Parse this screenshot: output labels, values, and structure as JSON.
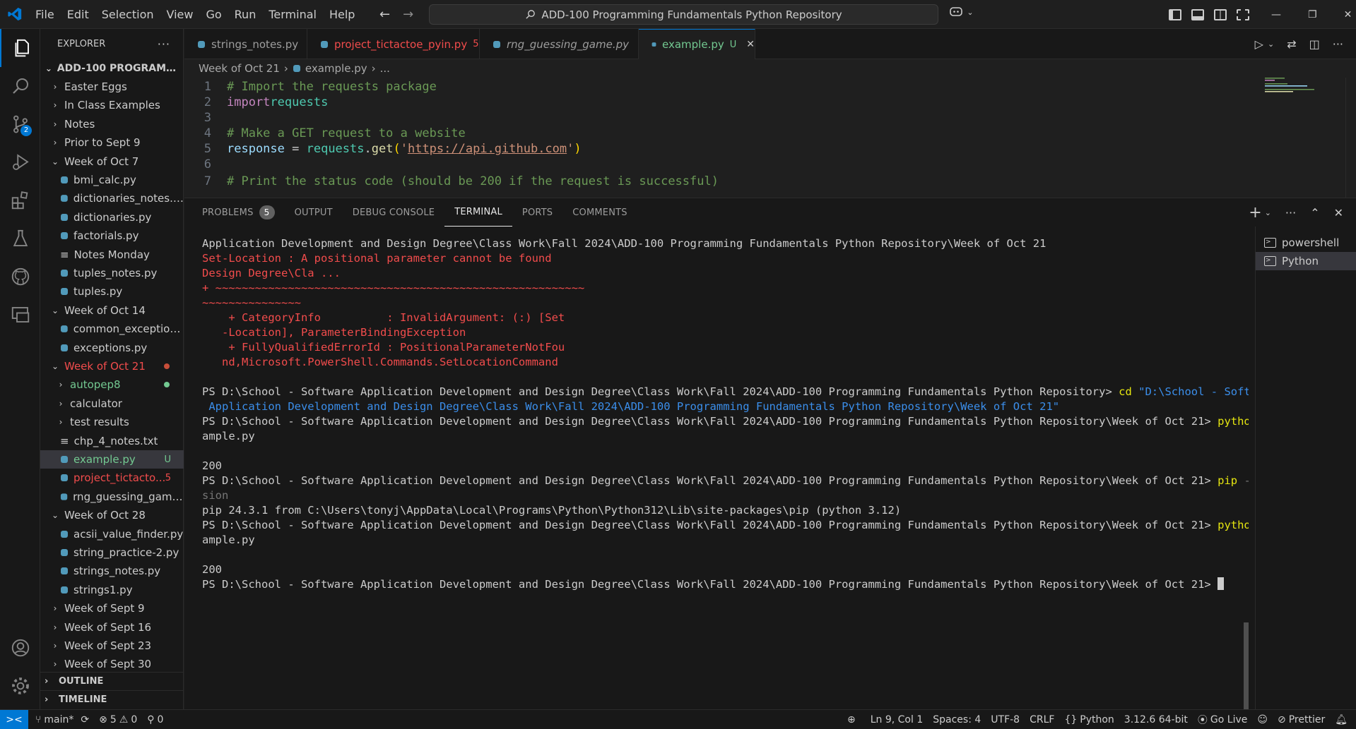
{
  "titlebar": {
    "menu": [
      "File",
      "Edit",
      "Selection",
      "View",
      "Go",
      "Run",
      "Terminal",
      "Help"
    ],
    "command_center": "ADD-100 Programming Fundamentals Python Repository"
  },
  "colors": {
    "accent": "#0078d4",
    "modified": "#e2c08d",
    "error": "#f14c4c",
    "untracked": "#73c991",
    "python_icon": "#519aba"
  },
  "activitybar": {
    "items": [
      "explorer-icon",
      "search-icon",
      "source-control-icon",
      "run-debug-icon",
      "extensions-icon",
      "testing-icon",
      "github-icon",
      "remote-explorer-icon"
    ],
    "scm_badge": "2",
    "bottom": [
      "accounts-icon",
      "settings-gear-icon"
    ]
  },
  "sidebar": {
    "title": "EXPLORER",
    "more": "···",
    "root": "ADD-100 PROGRAMMING...",
    "rows": [
      {
        "label": "Easter Eggs",
        "type": "folder",
        "depth": 1
      },
      {
        "label": "In Class Examples",
        "type": "folder",
        "depth": 1
      },
      {
        "label": "Notes",
        "type": "folder",
        "depth": 1
      },
      {
        "label": "Prior to Sept 9",
        "type": "folder",
        "depth": 1
      },
      {
        "label": "Week of Oct 7",
        "type": "folder-open",
        "depth": 1
      },
      {
        "label": "bmi_calc.py",
        "type": "py",
        "depth": 2
      },
      {
        "label": "dictionaries_notes.py",
        "type": "py",
        "depth": 2
      },
      {
        "label": "dictionaries.py",
        "type": "py",
        "depth": 2
      },
      {
        "label": "factorials.py",
        "type": "py",
        "depth": 2
      },
      {
        "label": "Notes Monday",
        "type": "txt",
        "depth": 2
      },
      {
        "label": "tuples_notes.py",
        "type": "py",
        "depth": 2
      },
      {
        "label": "tuples.py",
        "type": "py",
        "depth": 2
      },
      {
        "label": "Week of Oct 14",
        "type": "folder-open",
        "depth": 1
      },
      {
        "label": "common_exception...",
        "type": "py",
        "depth": 2
      },
      {
        "label": "exceptions.py",
        "type": "py",
        "depth": 2
      },
      {
        "label": "Week of Oct 21",
        "type": "folder-open",
        "depth": 1
      },
      {
        "label": "autopep8",
        "type": "folder",
        "depth": 2
      },
      {
        "label": "calculator",
        "type": "folder",
        "depth": 2
      },
      {
        "label": "test results",
        "type": "folder",
        "depth": 2
      },
      {
        "label": "chp_4_notes.txt",
        "type": "txt",
        "depth": 2
      },
      {
        "label": "example.py",
        "type": "py",
        "depth": 2
      },
      {
        "label": "project_tictacto...",
        "type": "py",
        "depth": 2
      },
      {
        "label": "rng_guessing_game....",
        "type": "py",
        "depth": 2
      },
      {
        "label": "Week of Oct 28",
        "type": "folder-open",
        "depth": 1
      },
      {
        "label": "acsii_value_finder.py",
        "type": "py",
        "depth": 2
      },
      {
        "label": "string_practice-2.py",
        "type": "py",
        "depth": 2
      },
      {
        "label": "strings_notes.py",
        "type": "py",
        "depth": 2
      },
      {
        "label": "strings1.py",
        "type": "py",
        "depth": 2
      },
      {
        "label": "Week of Sept 9",
        "type": "folder",
        "depth": 1
      },
      {
        "label": "Week of Sept 16",
        "type": "folder",
        "depth": 1
      },
      {
        "label": "Week of Sept 23",
        "type": "folder",
        "depth": 1
      },
      {
        "label": "Week of Sept 30",
        "type": "folder",
        "depth": 1
      }
    ],
    "example_deco": "U",
    "tictactoe_deco": "5",
    "outline": "OUTLINE",
    "timeline": "TIMELINE"
  },
  "tabs": [
    {
      "label": "strings_notes.py",
      "badge": ""
    },
    {
      "label": "project_tictactoe_pyin.py",
      "badge": "5"
    },
    {
      "label": "rng_guessing_game.py",
      "badge": ""
    },
    {
      "label": "example.py",
      "badge": "U"
    }
  ],
  "tab_close": "✕",
  "breadcrumb": {
    "folder": "Week of Oct 21",
    "file": "example.py",
    "more": "..."
  },
  "editor": {
    "line_numbers": [
      "1",
      "2",
      "3",
      "4",
      "5",
      "6",
      "7"
    ],
    "line1": "# Import the requests package",
    "line2_kw": "import",
    "line2_mod": "requests",
    "line4": "# Make a GET request to a website",
    "line5_var": "response",
    "line5_eq": " = ",
    "line5_mod": "requests",
    "line5_dot": ".",
    "line5_fn": "get",
    "line5_open": "(",
    "line5_q1": "'",
    "line5_url": "https://api.github.com",
    "line5_q2": "'",
    "line5_close": ")",
    "line7_partial": "# Print the status code (should be 200 if the request is successful)"
  },
  "panel": {
    "tabs": [
      "PROBLEMS",
      "OUTPUT",
      "DEBUG CONSOLE",
      "TERMINAL",
      "PORTS",
      "COMMENTS"
    ],
    "problems_count": "5",
    "terminals": [
      "powershell",
      "Python"
    ]
  },
  "terminal": {
    "l01": "Application Development and Design Degree\\Class Work\\Fall 2024\\ADD-100 Programming Fundamentals Python Repository\\Week of Oct 21",
    "l02": "Set-Location : A positional parameter cannot be found",
    "l03": "Design Degree\\Cla ...",
    "l04": "+ ~~~~~~~~~~~~~~~~~~~~~~~~~~~~~~~~~~~~~~~~~~~~~~~~~~~~~~~~",
    "l05": "~~~~~~~~~~~~~~~",
    "l06": "    + CategoryInfo          : InvalidArgument: (:) [Set",
    "l07": "   -Location], ParameterBindingException",
    "l08": "    + FullyQualifiedErrorId : PositionalParameterNotFou",
    "l09": "   nd,Microsoft.PowerShell.Commands.SetLocationCommand",
    "l10_prompt": "PS D:\\School - Software Application Development and Design Degree\\Class Work\\Fall 2024\\ADD-100 Programming Fundamentals Python Repository> ",
    "l10_cmd": "cd",
    "l10_arg": " \"D:\\School - Software",
    "l11": " Application Development and Design Degree\\Class Work\\Fall 2024\\ADD-100 Programming Fundamentals Python Repository\\Week of Oct 21\"",
    "prompt_oct21": "PS D:\\School - Software Application Development and Design Degree\\Class Work\\Fall 2024\\ADD-100 Programming Fundamentals Python Repository\\Week of Oct 21> ",
    "l12_cmd": "python ex",
    "l13": "ample.py",
    "l15": "200",
    "l16_cmd": "pip",
    "l16_arg": " --ver",
    "l17": "sion",
    "l18": "pip 24.3.1 from C:\\Users\\tonyj\\AppData\\Local\\Programs\\Python\\Python312\\Lib\\site-packages\\pip (python 3.12)",
    "l19_cmd": "python ex",
    "l20": "ample.py",
    "l22": "200"
  },
  "statusbar": {
    "remote": "><",
    "branch": "main*",
    "errors": "5",
    "warnings": "0",
    "ports": "0",
    "position": "Ln 9, Col 1",
    "spaces": "Spaces: 4",
    "encoding": "UTF-8",
    "eol": "CRLF",
    "language": "Python",
    "interpreter": "3.12.6 64-bit",
    "golive": "Go Live",
    "prettier": "Prettier"
  }
}
